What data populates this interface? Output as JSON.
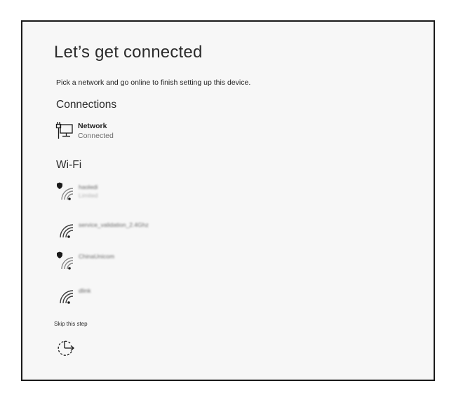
{
  "page": {
    "title": "Let’s get connected",
    "subtitle": "Pick a network and go online to finish setting up this device."
  },
  "connections": {
    "heading": "Connections",
    "items": [
      {
        "name": "Network",
        "status": "Connected",
        "icon": "wired-network-icon"
      }
    ]
  },
  "wifi": {
    "heading": "Wi-Fi",
    "networks": [
      {
        "ssid": "haoledi",
        "status": "Limited",
        "secured": true,
        "icon": "wifi-secured-icon"
      },
      {
        "ssid": "service_validation_2.4Ghz",
        "status": "",
        "secured": false,
        "icon": "wifi-icon"
      },
      {
        "ssid": "ChinaUnicom",
        "status": "",
        "secured": true,
        "icon": "wifi-secured-icon"
      },
      {
        "ssid": "dlink",
        "status": "",
        "secured": false,
        "icon": "wifi-icon"
      }
    ]
  },
  "skip": {
    "label": "Skip this step",
    "icon": "skip-clock-arrow-icon"
  },
  "colors": {
    "background": "#f7f7f7",
    "border": "#1a1a1a",
    "text": "#1f1f1f",
    "muted": "#6b6b6b"
  }
}
